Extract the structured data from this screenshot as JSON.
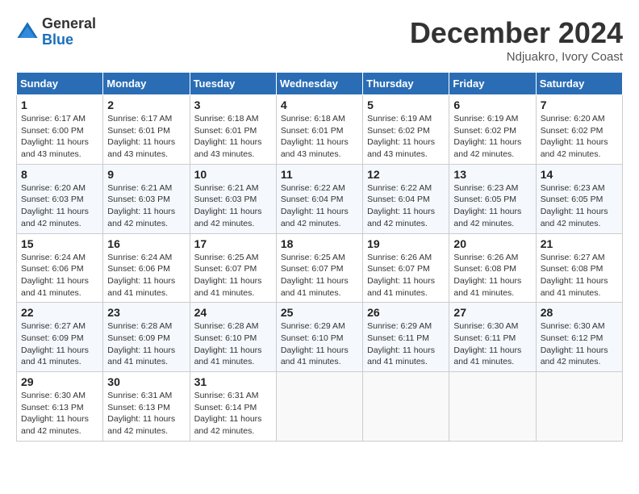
{
  "header": {
    "logo_general": "General",
    "logo_blue": "Blue",
    "month_title": "December 2024",
    "location": "Ndjuakro, Ivory Coast"
  },
  "calendar": {
    "days_of_week": [
      "Sunday",
      "Monday",
      "Tuesday",
      "Wednesday",
      "Thursday",
      "Friday",
      "Saturday"
    ],
    "weeks": [
      [
        {
          "day": "1",
          "sunrise": "6:17 AM",
          "sunset": "6:00 PM",
          "daylight": "11 hours and 43 minutes."
        },
        {
          "day": "2",
          "sunrise": "6:17 AM",
          "sunset": "6:01 PM",
          "daylight": "11 hours and 43 minutes."
        },
        {
          "day": "3",
          "sunrise": "6:18 AM",
          "sunset": "6:01 PM",
          "daylight": "11 hours and 43 minutes."
        },
        {
          "day": "4",
          "sunrise": "6:18 AM",
          "sunset": "6:01 PM",
          "daylight": "11 hours and 43 minutes."
        },
        {
          "day": "5",
          "sunrise": "6:19 AM",
          "sunset": "6:02 PM",
          "daylight": "11 hours and 43 minutes."
        },
        {
          "day": "6",
          "sunrise": "6:19 AM",
          "sunset": "6:02 PM",
          "daylight": "11 hours and 42 minutes."
        },
        {
          "day": "7",
          "sunrise": "6:20 AM",
          "sunset": "6:02 PM",
          "daylight": "11 hours and 42 minutes."
        }
      ],
      [
        {
          "day": "8",
          "sunrise": "6:20 AM",
          "sunset": "6:03 PM",
          "daylight": "11 hours and 42 minutes."
        },
        {
          "day": "9",
          "sunrise": "6:21 AM",
          "sunset": "6:03 PM",
          "daylight": "11 hours and 42 minutes."
        },
        {
          "day": "10",
          "sunrise": "6:21 AM",
          "sunset": "6:03 PM",
          "daylight": "11 hours and 42 minutes."
        },
        {
          "day": "11",
          "sunrise": "6:22 AM",
          "sunset": "6:04 PM",
          "daylight": "11 hours and 42 minutes."
        },
        {
          "day": "12",
          "sunrise": "6:22 AM",
          "sunset": "6:04 PM",
          "daylight": "11 hours and 42 minutes."
        },
        {
          "day": "13",
          "sunrise": "6:23 AM",
          "sunset": "6:05 PM",
          "daylight": "11 hours and 42 minutes."
        },
        {
          "day": "14",
          "sunrise": "6:23 AM",
          "sunset": "6:05 PM",
          "daylight": "11 hours and 42 minutes."
        }
      ],
      [
        {
          "day": "15",
          "sunrise": "6:24 AM",
          "sunset": "6:06 PM",
          "daylight": "11 hours and 41 minutes."
        },
        {
          "day": "16",
          "sunrise": "6:24 AM",
          "sunset": "6:06 PM",
          "daylight": "11 hours and 41 minutes."
        },
        {
          "day": "17",
          "sunrise": "6:25 AM",
          "sunset": "6:07 PM",
          "daylight": "11 hours and 41 minutes."
        },
        {
          "day": "18",
          "sunrise": "6:25 AM",
          "sunset": "6:07 PM",
          "daylight": "11 hours and 41 minutes."
        },
        {
          "day": "19",
          "sunrise": "6:26 AM",
          "sunset": "6:07 PM",
          "daylight": "11 hours and 41 minutes."
        },
        {
          "day": "20",
          "sunrise": "6:26 AM",
          "sunset": "6:08 PM",
          "daylight": "11 hours and 41 minutes."
        },
        {
          "day": "21",
          "sunrise": "6:27 AM",
          "sunset": "6:08 PM",
          "daylight": "11 hours and 41 minutes."
        }
      ],
      [
        {
          "day": "22",
          "sunrise": "6:27 AM",
          "sunset": "6:09 PM",
          "daylight": "11 hours and 41 minutes."
        },
        {
          "day": "23",
          "sunrise": "6:28 AM",
          "sunset": "6:09 PM",
          "daylight": "11 hours and 41 minutes."
        },
        {
          "day": "24",
          "sunrise": "6:28 AM",
          "sunset": "6:10 PM",
          "daylight": "11 hours and 41 minutes."
        },
        {
          "day": "25",
          "sunrise": "6:29 AM",
          "sunset": "6:10 PM",
          "daylight": "11 hours and 41 minutes."
        },
        {
          "day": "26",
          "sunrise": "6:29 AM",
          "sunset": "6:11 PM",
          "daylight": "11 hours and 41 minutes."
        },
        {
          "day": "27",
          "sunrise": "6:30 AM",
          "sunset": "6:11 PM",
          "daylight": "11 hours and 41 minutes."
        },
        {
          "day": "28",
          "sunrise": "6:30 AM",
          "sunset": "6:12 PM",
          "daylight": "11 hours and 42 minutes."
        }
      ],
      [
        {
          "day": "29",
          "sunrise": "6:30 AM",
          "sunset": "6:13 PM",
          "daylight": "11 hours and 42 minutes."
        },
        {
          "day": "30",
          "sunrise": "6:31 AM",
          "sunset": "6:13 PM",
          "daylight": "11 hours and 42 minutes."
        },
        {
          "day": "31",
          "sunrise": "6:31 AM",
          "sunset": "6:14 PM",
          "daylight": "11 hours and 42 minutes."
        },
        null,
        null,
        null,
        null
      ]
    ]
  }
}
